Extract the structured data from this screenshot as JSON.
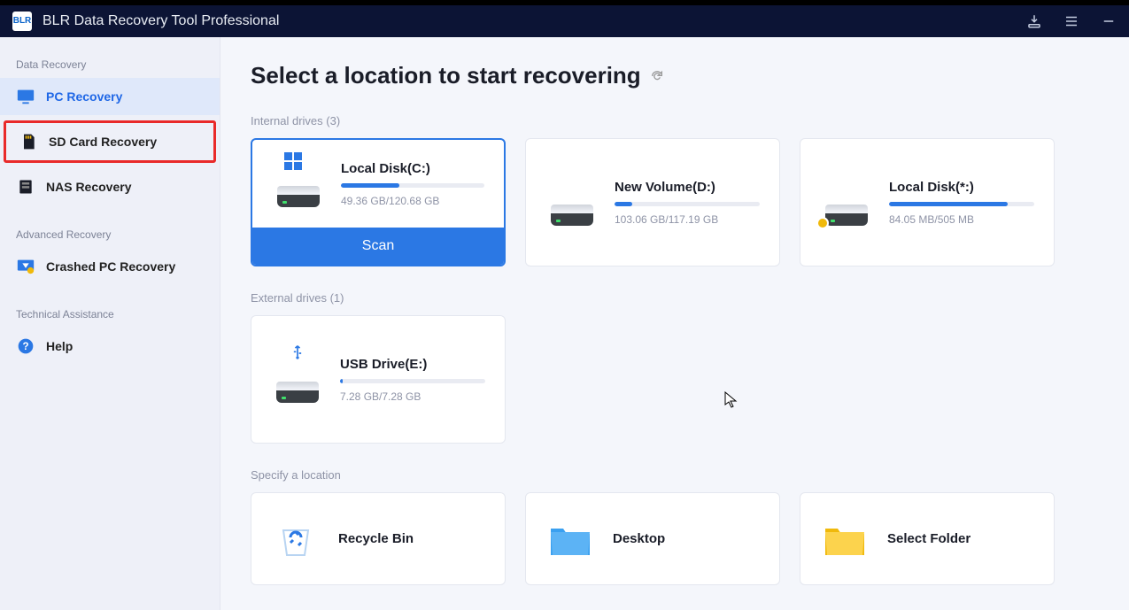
{
  "app": {
    "logo_text": "BLR",
    "title": "BLR Data Recovery Tool Professional"
  },
  "sidebar": {
    "sections": [
      {
        "label": "Data Recovery",
        "items": [
          {
            "icon": "monitor",
            "label": "PC Recovery",
            "active": true
          },
          {
            "icon": "sdcard",
            "label": "SD Card Recovery",
            "highlighted": true
          },
          {
            "icon": "nas",
            "label": "NAS Recovery"
          }
        ]
      },
      {
        "label": "Advanced Recovery",
        "items": [
          {
            "icon": "crashed",
            "label": "Crashed PC Recovery"
          }
        ]
      },
      {
        "label": "Technical Assistance",
        "items": [
          {
            "icon": "help",
            "label": "Help"
          }
        ]
      }
    ]
  },
  "main": {
    "title": "Select a location to start recovering",
    "internal_label": "Internal drives (3)",
    "internal_drives": [
      {
        "name": "Local Disk(C:)",
        "size": "49.36 GB/120.68 GB",
        "fill_pct": 41,
        "selected": true,
        "scan_label": "Scan",
        "badge": "windows"
      },
      {
        "name": "New Volume(D:)",
        "size": "103.06 GB/117.19 GB",
        "fill_pct": 12
      },
      {
        "name": "Local Disk(*:)",
        "size": "84.05 MB/505 MB",
        "fill_pct": 82,
        "badge": "warn"
      }
    ],
    "external_label": "External drives (1)",
    "external_drives": [
      {
        "name": "USB Drive(E:)",
        "size": "7.28 GB/7.28 GB",
        "fill_pct": 2,
        "badge": "usb"
      }
    ],
    "specify_label": "Specify a location",
    "locations": [
      {
        "icon": "recycle",
        "label": "Recycle Bin"
      },
      {
        "icon": "desktop-folder",
        "label": "Desktop"
      },
      {
        "icon": "select-folder",
        "label": "Select Folder"
      }
    ]
  }
}
